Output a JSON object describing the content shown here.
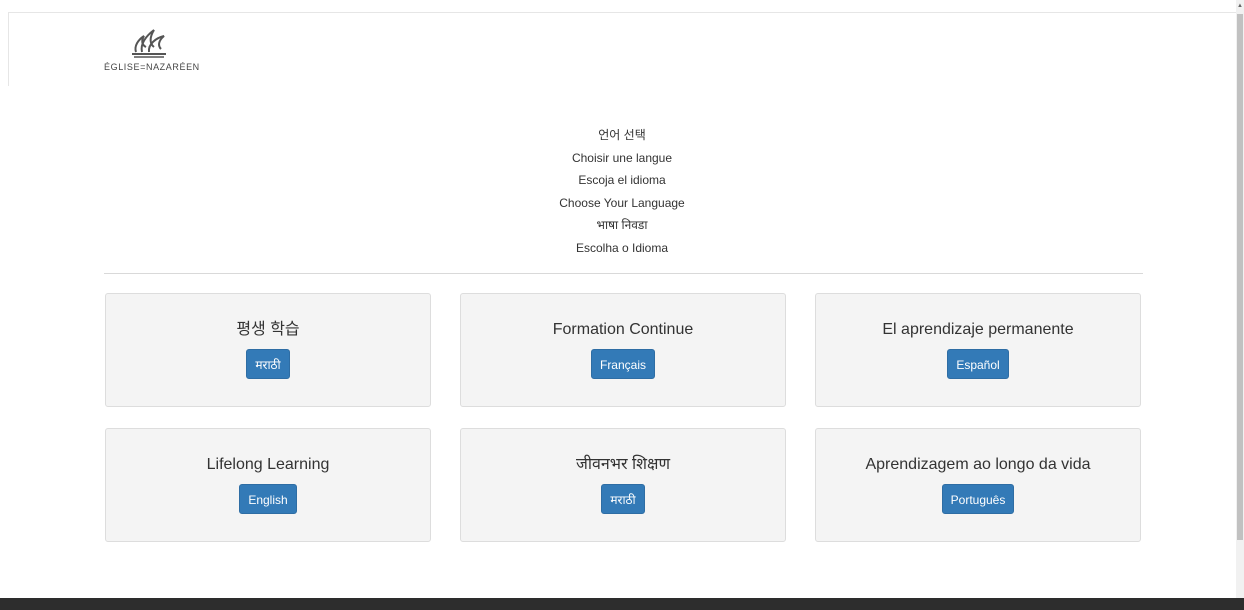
{
  "logo": {
    "text": "ÉGLISE=NAZARÉEN"
  },
  "language_prompt": [
    "언어 선택",
    "Choisir une langue",
    "Escoja el idioma",
    "Choose Your Language",
    "भाषा निवडा",
    "Escolha o Idioma"
  ],
  "cards": [
    {
      "title": "평생 학습",
      "button": "मराठी"
    },
    {
      "title": "Formation Continue",
      "button": "Français"
    },
    {
      "title": "El aprendizaje permanente",
      "button": "Español"
    },
    {
      "title": "Lifelong Learning",
      "button": "English"
    },
    {
      "title": "जीवनभर शिक्षण",
      "button": "मराठी"
    },
    {
      "title": "Aprendizagem ao longo da vida",
      "button": "Português"
    }
  ],
  "colors": {
    "button": "#337ab7",
    "card_background": "#f4f4f4",
    "footer": "#2d2d2d"
  }
}
